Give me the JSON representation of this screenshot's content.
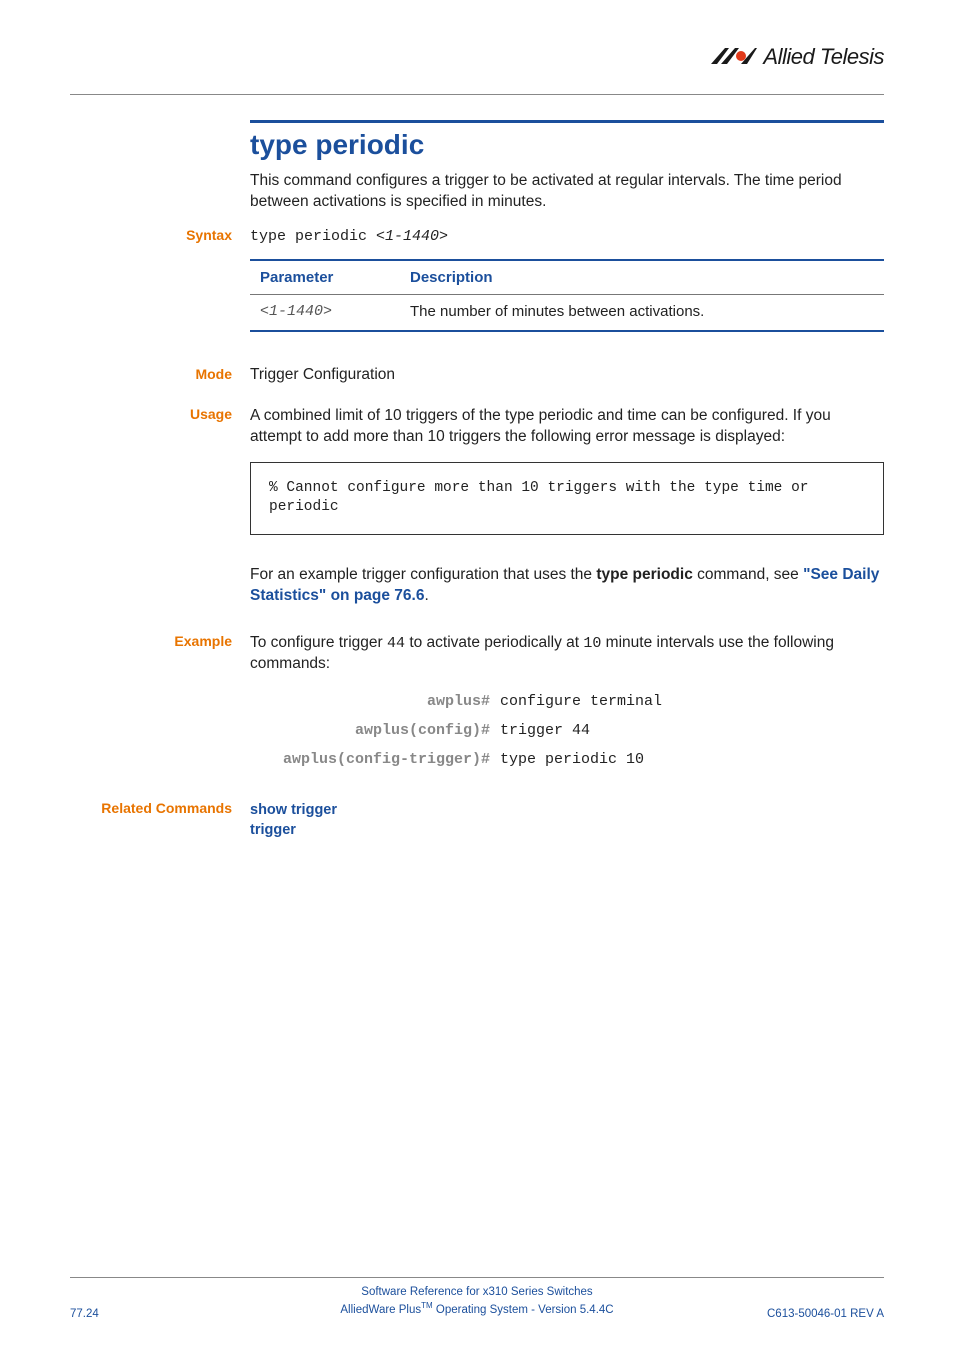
{
  "logo_text": "Allied Telesis",
  "title": "type periodic",
  "intro": "This command configures a trigger to be activated at regular intervals. The time period between activations is specified in minutes.",
  "labels": {
    "syntax": "Syntax",
    "mode": "Mode",
    "usage": "Usage",
    "example": "Example",
    "related": "Related Commands"
  },
  "syntax_cmd": "type periodic ",
  "syntax_param": "<1-1440>",
  "param_table": {
    "headers": {
      "param": "Parameter",
      "desc": "Description"
    },
    "row": {
      "param": "<1-1440>",
      "desc": "The number of minutes between activations."
    }
  },
  "mode_text": "Trigger Configuration",
  "usage_text": "A combined limit of 10 triggers of the type periodic and time can be configured. If you attempt to add more than 10 triggers the following error message is displayed:",
  "usage_codebox": "% Cannot configure more than 10 triggers with the type time or periodic",
  "usage_after_pre": "For an example trigger configuration that uses the ",
  "usage_after_bold": "type periodic",
  "usage_after_mid": " command, see ",
  "usage_after_link": "\"See Daily Statistics\" on page 76.6",
  "usage_after_post": ".",
  "example_intro_pre": "To configure trigger ",
  "example_intro_trig": "44",
  "example_intro_mid": " to activate periodically at ",
  "example_intro_int": "10",
  "example_intro_post": " minute intervals use the following commands:",
  "example_lines": [
    {
      "prompt": "awplus#",
      "cmd": "configure terminal"
    },
    {
      "prompt": "awplus(config)#",
      "cmd": "trigger 44"
    },
    {
      "prompt": "awplus(config-trigger)#",
      "cmd": "type periodic 10"
    }
  ],
  "related": [
    "show trigger",
    "trigger"
  ],
  "footer": {
    "page": "77.24",
    "center1": "Software Reference for x310 Series Switches",
    "center2_pre": "AlliedWare Plus",
    "center2_tm": "TM",
    "center2_post": " Operating System  - Version 5.4.4C",
    "right": "C613-50046-01 REV A"
  }
}
